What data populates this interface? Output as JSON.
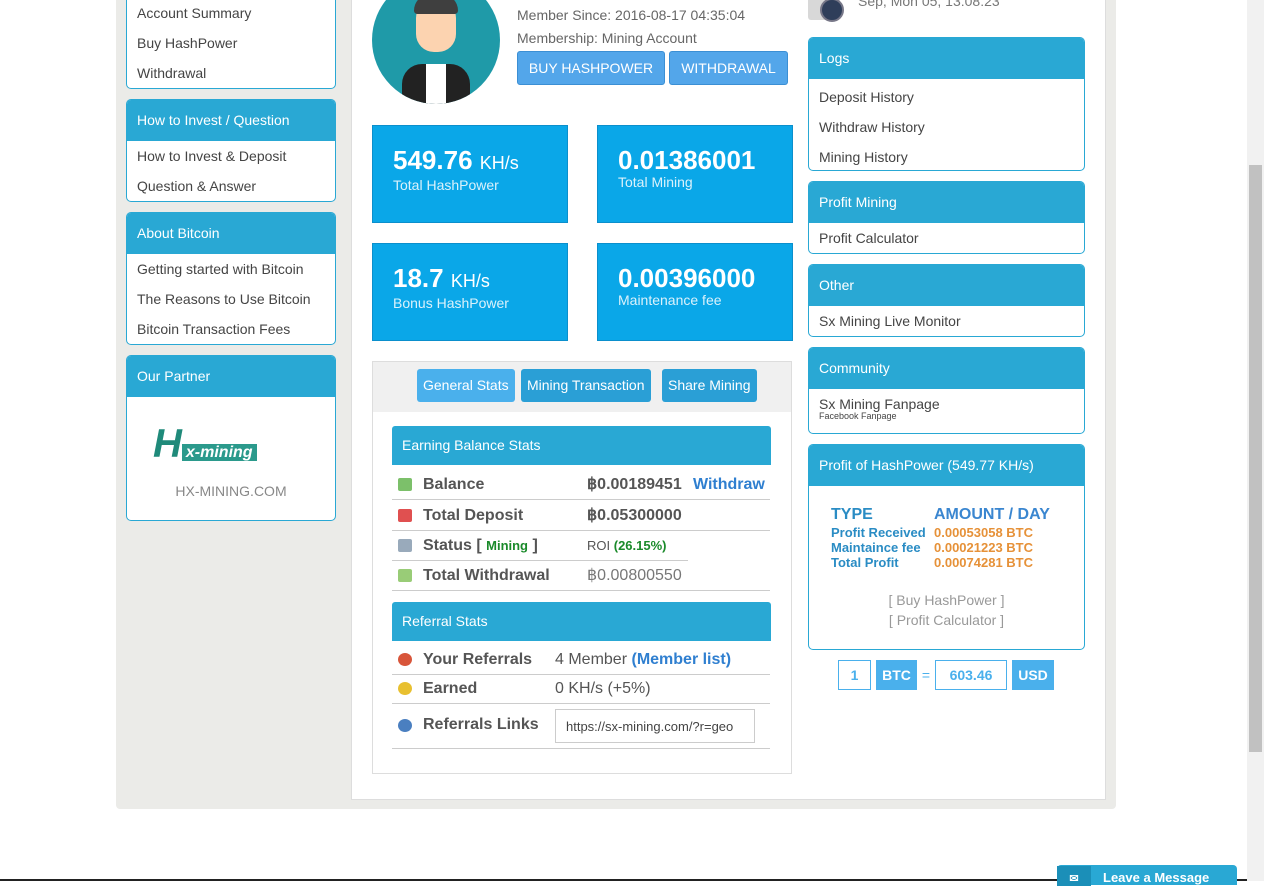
{
  "sidebar": {
    "account_items": [
      "Account Summary",
      "Buy HashPower",
      "Withdrawal"
    ],
    "invest": {
      "title": "How to Invest / Question",
      "items": [
        "How to Invest & Deposit",
        "Question & Answer"
      ]
    },
    "bitcoin": {
      "title": "About Bitcoin",
      "items": [
        "Getting started with Bitcoin",
        "The Reasons to Use Bitcoin",
        "Bitcoin Transaction Fees"
      ]
    },
    "partner": {
      "title": "Our Partner",
      "logo_text": "Hx-mining",
      "link": "HX-MINING.COM"
    }
  },
  "profile": {
    "member_since": "Member Since: 2016-08-17 04:35:04",
    "membership": "Membership: Mining Account",
    "buy_button": "BUY HASHPOWER",
    "withdraw_button": "WITHDRAWAL"
  },
  "stats": [
    {
      "value": "549.76",
      "unit": "KH/s",
      "label": "Total HashPower"
    },
    {
      "value": "0.01386001",
      "unit": "",
      "label": "Total Mining"
    },
    {
      "value": "18.7",
      "unit": "KH/s",
      "label": "Bonus HashPower"
    },
    {
      "value": "0.00396000",
      "unit": "",
      "label": "Maintenance fee"
    }
  ],
  "tabs": [
    "General Stats",
    "Mining Transaction",
    "Share Mining"
  ],
  "earning": {
    "title": "Earning Balance Stats",
    "balance_label": "Balance",
    "balance": "฿0.00189451",
    "withdraw_link": "Withdraw",
    "deposit_label": "Total Deposit",
    "deposit": "฿0.05300000",
    "status_label": "Status [",
    "status_value": "Mining",
    "status_close": "]",
    "roi_label": "ROI",
    "roi": "(26.15%)",
    "withdrawal_label": "Total Withdrawal",
    "withdrawal": "฿0.00800550"
  },
  "referral": {
    "title": "Referral Stats",
    "referrals_label": "Your Referrals",
    "referrals": "4 Member",
    "member_list": "(Member list)",
    "earned_label": "Earned",
    "earned": "0 KH/s (+5%)",
    "links_label": "Referrals Links",
    "link_value": "https://sx-mining.com/?r=geo"
  },
  "clock": {
    "text": "Sep, Mon 05, 13:08:23"
  },
  "right": {
    "logs": {
      "title": "Logs",
      "items": [
        "Deposit History",
        "Withdraw History",
        "Mining History"
      ]
    },
    "profit": {
      "title": "Profit Mining",
      "items": [
        "Profit Calculator"
      ]
    },
    "other": {
      "title": "Other",
      "items": [
        "Sx Mining Live Monitor"
      ]
    },
    "community": {
      "title": "Community",
      "item": "Sx Mining Fanpage",
      "sub": "Facebook Fanpage"
    },
    "hash": {
      "title": "Profit of HashPower (549.77 KH/s)",
      "type_h": "TYPE",
      "amount_h": "AMOUNT / DAY",
      "rows": [
        {
          "t": "Profit Received",
          "a": "0.00053058 BTC"
        },
        {
          "t": "Maintaince fee",
          "a": "0.00021223 BTC"
        },
        {
          "t": "Total Profit",
          "a": "0.00074281 BTC"
        }
      ],
      "buy": "[ Buy HashPower ]",
      "calc": "[ Profit Calculator ]"
    }
  },
  "converter": {
    "amount": "1",
    "from": "BTC",
    "eq": "=",
    "result": "603.46",
    "to": "USD"
  },
  "chat": {
    "label": "Leave a Message"
  }
}
